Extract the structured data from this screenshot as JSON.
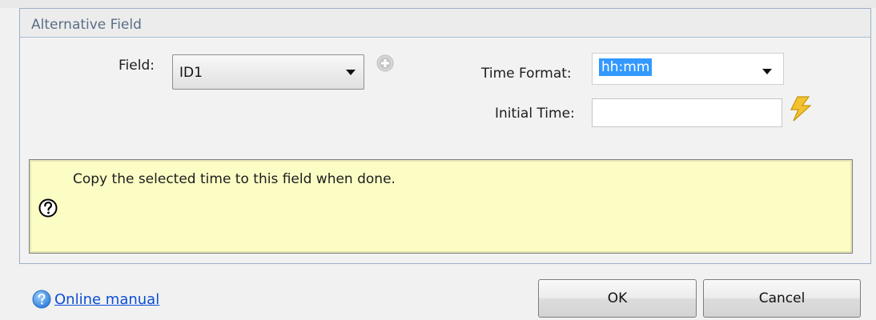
{
  "group": {
    "title": "Alternative Field"
  },
  "field": {
    "label": "Field:",
    "value": "ID1"
  },
  "time_format": {
    "label": "Time Format:",
    "value": "hh:mm"
  },
  "initial_time": {
    "label": "Initial Time:",
    "value": ""
  },
  "hint": {
    "text": "Copy the selected time to this field when done."
  },
  "footer": {
    "manual_label": "Online manual",
    "ok_label": "OK",
    "cancel_label": "Cancel"
  },
  "icons": {
    "add": "add-icon",
    "bolt": "lightning-bolt-icon",
    "help": "question-mark-icon",
    "manual": "help-icon"
  },
  "colors": {
    "hint_background": "#fcfdc5",
    "link": "#0b4ed6",
    "selection": "#3399ff",
    "group_title": "#5a6e86"
  }
}
